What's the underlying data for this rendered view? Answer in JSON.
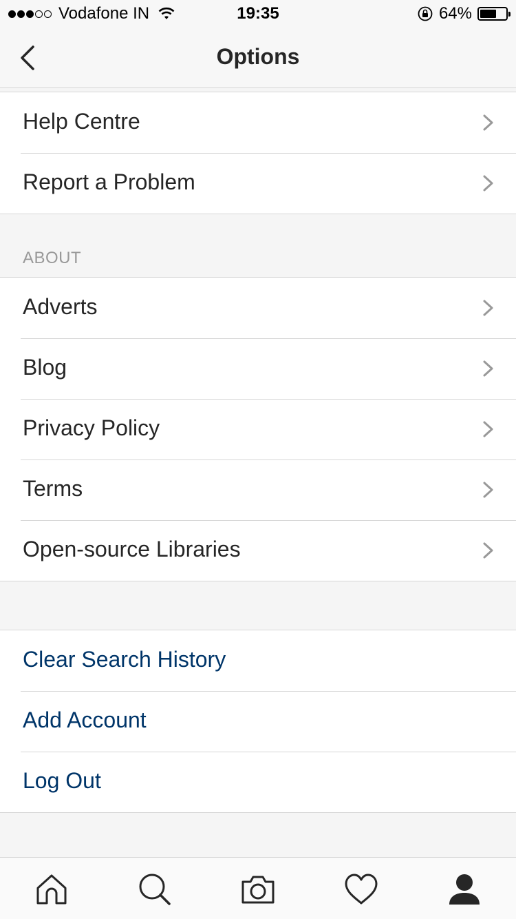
{
  "status_bar": {
    "carrier": "Vodafone IN",
    "time": "19:35",
    "battery": "64%",
    "battery_level": 0.64,
    "signal_bars_filled": 3,
    "signal_bars_total": 5
  },
  "nav": {
    "title": "Options",
    "back_icon": "chevron-left-icon"
  },
  "support_group": {
    "items": [
      {
        "label": "Help Centre"
      },
      {
        "label": "Report a Problem"
      }
    ]
  },
  "about_group": {
    "header": "ABOUT",
    "items": [
      {
        "label": "Adverts"
      },
      {
        "label": "Blog"
      },
      {
        "label": "Privacy Policy"
      },
      {
        "label": "Terms"
      },
      {
        "label": "Open-source Libraries"
      }
    ]
  },
  "account_group": {
    "items": [
      {
        "label": "Clear Search History"
      },
      {
        "label": "Add Account"
      },
      {
        "label": "Log Out"
      }
    ]
  },
  "tab_bar": {
    "tabs": [
      "home-icon",
      "search-icon",
      "camera-icon",
      "heart-icon",
      "profile-icon"
    ],
    "active": "profile-icon"
  },
  "colors": {
    "action_text": "#003569",
    "section_header": "#999999",
    "chevron": "#999999"
  }
}
